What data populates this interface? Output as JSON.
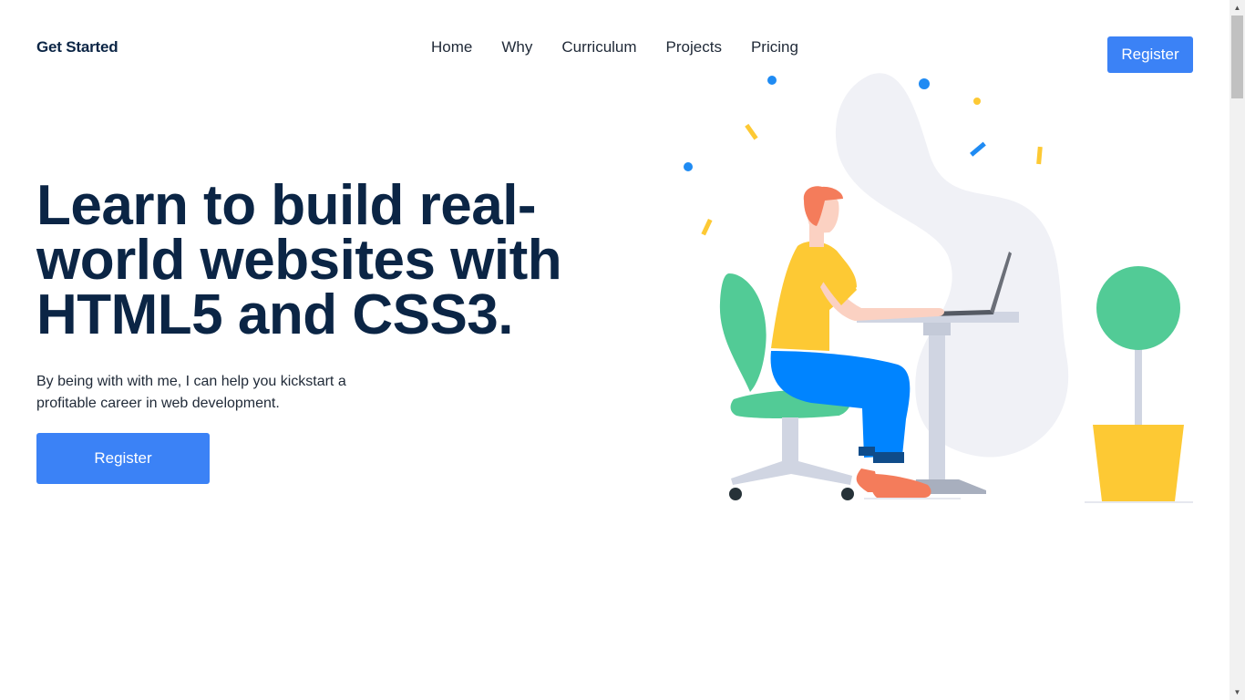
{
  "header": {
    "logo": "Get Started",
    "nav": [
      {
        "label": "Home"
      },
      {
        "label": "Why"
      },
      {
        "label": "Curriculum"
      },
      {
        "label": "Projects"
      },
      {
        "label": "Pricing"
      }
    ],
    "register_label": "Register"
  },
  "hero": {
    "title": "Learn to build real-world websites with HTML5 and CSS3.",
    "subtitle": "By being with with me, I can help you kickstart a profitable career in web development.",
    "cta_label": "Register"
  },
  "illustration": {
    "icon": "person-at-desk-illustration",
    "colors": {
      "accent_blue": "#3b82f6",
      "navy": "#0b2545",
      "green": "#52cb96",
      "yellow": "#fdc934",
      "blob": "#f0f1f6",
      "furniture": "#d0d5e2",
      "skin": "#fbd1c2",
      "hair": "#f47c5b"
    }
  }
}
